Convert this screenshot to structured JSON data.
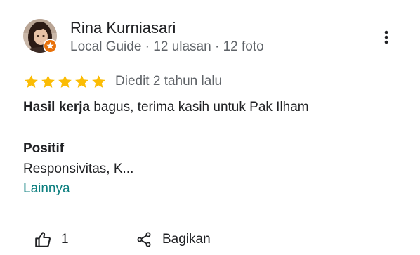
{
  "reviewer": {
    "name": "Rina Kurniasari",
    "meta": "Local Guide · 12 ulasan · 12 foto",
    "avatar_icon": "user-avatar-photo",
    "badge_icon": "local-guide-badge-icon",
    "badge_color": "#e8710a"
  },
  "rating": {
    "stars": 5,
    "max": 5,
    "star_color": "#fbbc04",
    "edited_text": "Diedit 2 tahun lalu"
  },
  "review": {
    "bold_prefix": "Hasil kerja",
    "text_rest": " bagus, terima kasih untuk Pak Ilham"
  },
  "positive": {
    "title": "Positif",
    "value": "Responsivitas, K...",
    "more_label": "Lainnya",
    "more_color": "#0b7e7e"
  },
  "actions": {
    "like_icon": "thumbs-up-icon",
    "like_count": "1",
    "share_icon": "share-icon",
    "share_label": "Bagikan",
    "more_icon": "more-vert-icon"
  }
}
